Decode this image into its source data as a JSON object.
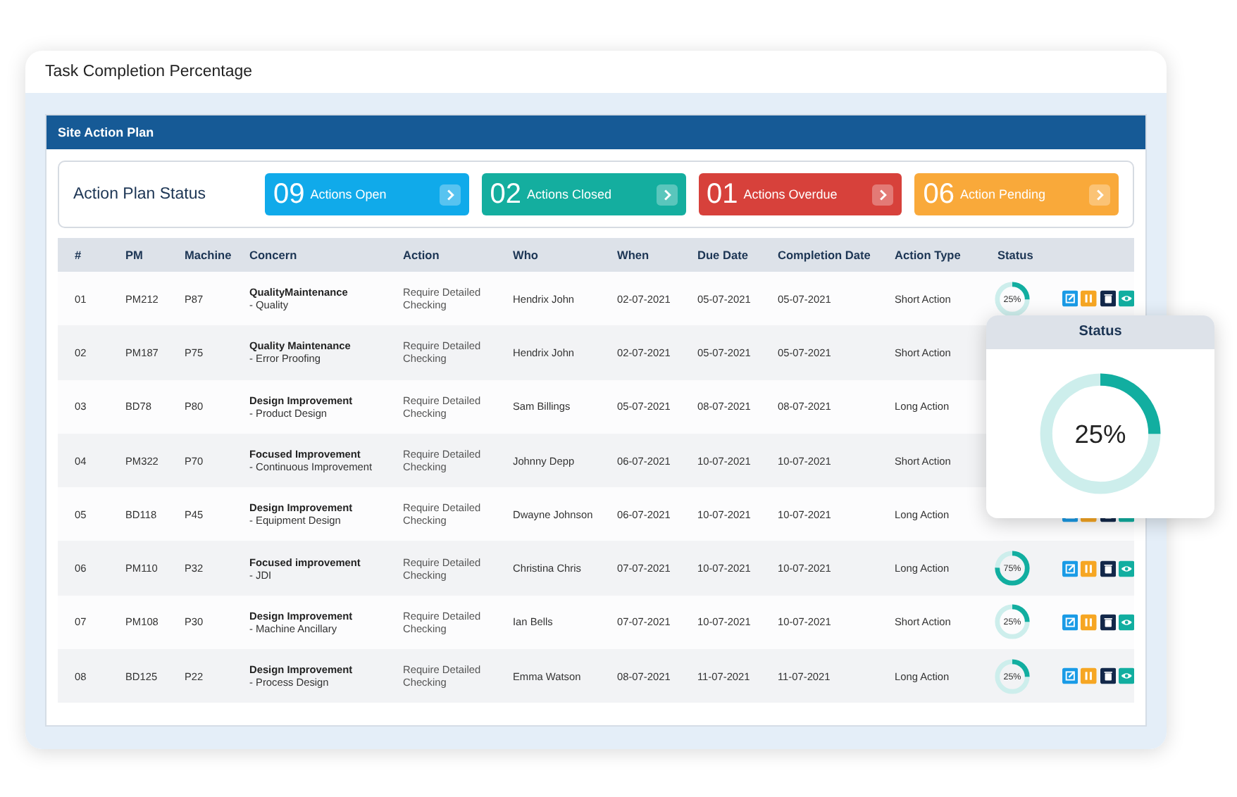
{
  "window": {
    "title": "Task Completion Percentage"
  },
  "panel": {
    "title": "Site Action Plan"
  },
  "status_summary": {
    "label": "Action Plan Status",
    "cards": [
      {
        "count": "09",
        "label": "Actions Open",
        "color": "#10aaea"
      },
      {
        "count": "02",
        "label": "Actions Closed",
        "color": "#14ae9f"
      },
      {
        "count": "01",
        "label": "Actions Overdue",
        "color": "#d7413b"
      },
      {
        "count": "06",
        "label": "Action Pending",
        "color": "#f9a93a"
      }
    ]
  },
  "table": {
    "columns": [
      "#",
      "PM",
      "Machine",
      "Concern",
      "Action",
      "Who",
      "When",
      "Due Date",
      "Completion Date",
      "Action Type",
      "Status"
    ],
    "rows": [
      {
        "no": "01",
        "pm": "PM212",
        "machine": "P87",
        "concern": "QualityMaintenance",
        "concern_detail": "- Quality",
        "action": "Require Detailed Checking",
        "who": "Hendrix John",
        "when": "02-07-2021",
        "due_date": "05-07-2021",
        "completion_date": "05-07-2021",
        "action_type": "Short Action",
        "status": {
          "level": 0.25,
          "label": "25%"
        }
      },
      {
        "no": "02",
        "pm": "PM187",
        "machine": "P75",
        "concern": "Quality Maintenance",
        "concern_detail": "- Error Proofing",
        "action": "Require Detailed Checking",
        "who": "Hendrix John",
        "when": "02-07-2021",
        "due_date": "05-07-2021",
        "completion_date": "05-07-2021",
        "action_type": "Short Action"
      },
      {
        "no": "03",
        "pm": "BD78",
        "machine": "P80",
        "concern": "Design Improvement",
        "concern_detail": "- Product Design",
        "action": "Require Detailed Checking",
        "who": "Sam Billings",
        "when": "05-07-2021",
        "due_date": "08-07-2021",
        "completion_date": "08-07-2021",
        "action_type": "Long Action"
      },
      {
        "no": "04",
        "pm": "PM322",
        "machine": "P70",
        "concern": "Focused Improvement",
        "concern_detail": "- Continuous Improvement",
        "action": "Require Detailed Checking",
        "who": "Johnny Depp",
        "when": "06-07-2021",
        "due_date": "10-07-2021",
        "completion_date": "10-07-2021",
        "action_type": "Short Action"
      },
      {
        "no": "05",
        "pm": "BD118",
        "machine": "P45",
        "concern": "Design Improvement",
        "concern_detail": "- Equipment Design",
        "action": "Require Detailed Checking",
        "who": "Dwayne Johnson",
        "when": "06-07-2021",
        "due_date": "10-07-2021",
        "completion_date": "10-07-2021",
        "action_type": "Long Action"
      },
      {
        "no": "06",
        "pm": "PM110",
        "machine": "P32",
        "concern": "Focused improvement",
        "concern_detail": "- JDI",
        "action": "Require Detailed Checking",
        "who": "Christina Chris",
        "when": "07-07-2021",
        "due_date": "10-07-2021",
        "completion_date": "10-07-2021",
        "action_type": "Long Action",
        "status": {
          "level": 0.75,
          "label": "75%"
        }
      },
      {
        "no": "07",
        "pm": "PM108",
        "machine": "P30",
        "concern": "Design Improvement",
        "concern_detail": "- Machine Ancillary",
        "action": "Require Detailed Checking",
        "who": "Ian Bells",
        "when": "07-07-2021",
        "due_date": "10-07-2021",
        "completion_date": "10-07-2021",
        "action_type": "Short Action",
        "status": {
          "level": 0.25,
          "label": "25%"
        }
      },
      {
        "no": "08",
        "pm": "BD125",
        "machine": "P22",
        "concern": "Design Improvement",
        "concern_detail": "- Process Design",
        "action": "Require Detailed Checking",
        "who": "Emma Watson",
        "when": "08-07-2021",
        "due_date": "11-07-2021",
        "completion_date": "11-07-2021",
        "action_type": "Long Action",
        "status": {
          "level": 0.25,
          "label": "25%"
        }
      }
    ]
  },
  "status_popup": {
    "title": "Status",
    "level": 0.25,
    "label": "25%"
  }
}
